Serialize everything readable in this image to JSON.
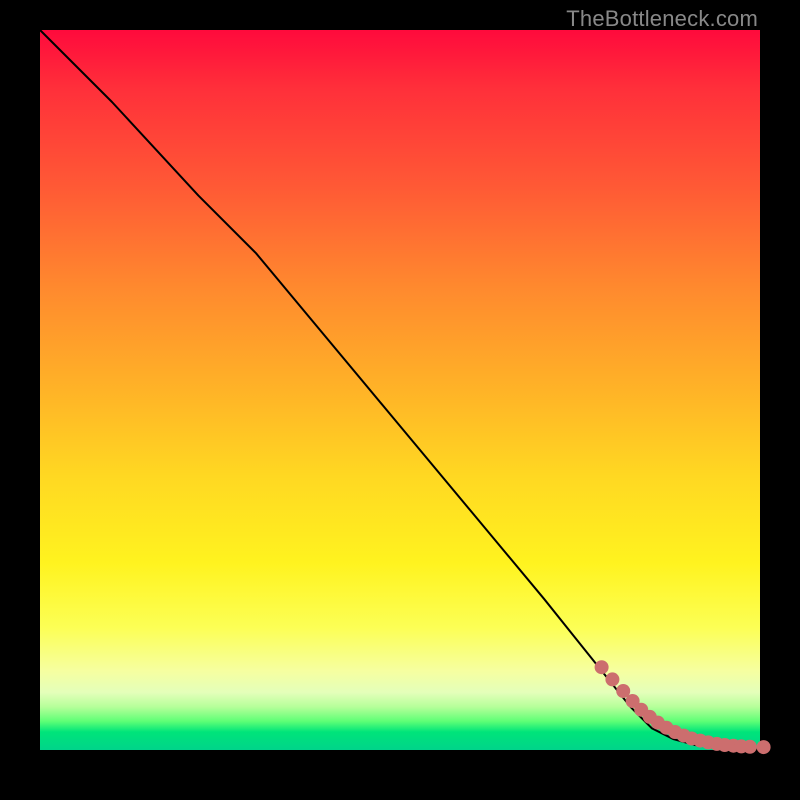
{
  "watermark": "TheBottleneck.com",
  "colors": {
    "dot": "#cc6e6e",
    "curve": "#000000",
    "frame": "#000000"
  },
  "chart_data": {
    "type": "line",
    "title": "",
    "xlabel": "",
    "ylabel": "",
    "xlim": [
      0,
      100
    ],
    "ylim": [
      0,
      100
    ],
    "grid": false,
    "legend": false,
    "series": [
      {
        "name": "curve",
        "x": [
          0,
          10,
          22,
          30,
          40,
          50,
          60,
          70,
          78,
          82,
          85,
          88,
          91,
          94,
          97,
          100
        ],
        "y": [
          100,
          90,
          77,
          69,
          57,
          45,
          33,
          21,
          11,
          6,
          3,
          1.5,
          0.7,
          0.3,
          0.1,
          0.05
        ]
      }
    ],
    "scatter": {
      "name": "tail-points",
      "x": [
        78,
        79.5,
        81,
        82.3,
        83.5,
        84.7,
        85.8,
        87,
        88.2,
        89.4,
        90.5,
        91.7,
        92.8,
        94,
        95.1,
        96.3,
        97.4,
        98.6,
        100.5
      ],
      "y": [
        11.5,
        9.8,
        8.2,
        6.8,
        5.6,
        4.6,
        3.8,
        3.1,
        2.5,
        2.0,
        1.6,
        1.3,
        1.05,
        0.85,
        0.7,
        0.6,
        0.5,
        0.45,
        0.4
      ]
    },
    "background_gradient": {
      "orientation": "vertical",
      "stops": [
        {
          "pos": 0.0,
          "color": "#ff0a3c"
        },
        {
          "pos": 0.5,
          "color": "#ffb327"
        },
        {
          "pos": 0.8,
          "color": "#fcff55"
        },
        {
          "pos": 0.96,
          "color": "#5fff76"
        },
        {
          "pos": 1.0,
          "color": "#00d48a"
        }
      ]
    }
  }
}
